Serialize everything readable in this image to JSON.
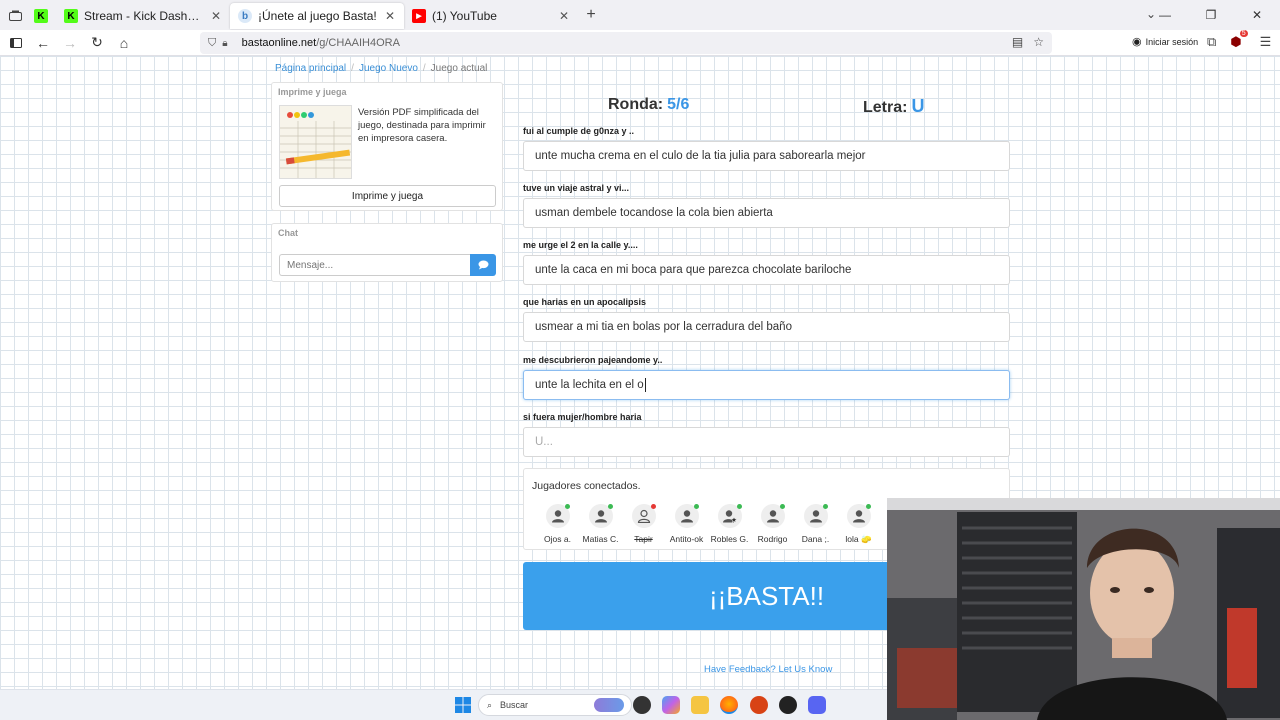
{
  "browser": {
    "tabs": [
      {
        "label": "",
        "favicon": "kick-icon",
        "color": "#53fc18"
      },
      {
        "label": "Stream - Kick Dashboard",
        "favicon": "kick-icon",
        "color": "#53fc18"
      },
      {
        "label": "¡Únete al juego Basta!",
        "favicon": "basta-icon",
        "color": "#7fb4e8",
        "active": true
      },
      {
        "label": "(1) YouTube",
        "favicon": "youtube-icon",
        "color": "#ff0000"
      }
    ],
    "url_host": "bastaonline.net",
    "url_path": "/g/CHAAIH4ORA",
    "signin_label": "Iniciar sesión",
    "notification_count": "5"
  },
  "breadcrumb": {
    "home": "Página principal",
    "new_game": "Juego Nuevo",
    "current": "Juego actual"
  },
  "print_panel": {
    "title": "Imprime y juega",
    "description": "Versión PDF simplificada del juego, destinada para imprimir en impresora casera.",
    "button_label": "Imprime y juega"
  },
  "chat": {
    "title": "Chat",
    "placeholder": "Mensaje..."
  },
  "game": {
    "round_label": "Ronda:",
    "round_value": "5/6",
    "letter_label": "Letra:",
    "letter_value": "U"
  },
  "questions": [
    {
      "label": "fui al cumple de g0nza y ..",
      "answer": "unte mucha crema en el culo de la tia julia para saborearla mejor"
    },
    {
      "label": "tuve un viaje astral y vi...",
      "answer": "usman dembele tocandose la cola bien abierta"
    },
    {
      "label": "me urge el 2 en la calle y....",
      "answer": "unte la caca en mi boca para que parezca chocolate bariloche"
    },
    {
      "label": "que harias en un apocalipsis",
      "answer": "usmear a mi tia en bolas por la cerradura del baño"
    },
    {
      "label": "me descubrieron pajeandome y..",
      "answer": "unte la lechita en el o"
    },
    {
      "label": "si fuera mujer/hombre haria",
      "answer": "",
      "placeholder": "U..."
    }
  ],
  "players": {
    "title": "Jugadores conectados.",
    "list": [
      {
        "name": "Ojos a.",
        "status": "online"
      },
      {
        "name": "Matias C.",
        "status": "online"
      },
      {
        "name": "Tapir",
        "status": "offline",
        "strike": true
      },
      {
        "name": "Antito-ok",
        "status": "online"
      },
      {
        "name": "Robles G.",
        "status": "online",
        "star": true
      },
      {
        "name": "Rodrigo",
        "status": "online"
      },
      {
        "name": "Dana ;.",
        "status": "online"
      },
      {
        "name": "lola 🧽",
        "status": "online"
      }
    ]
  },
  "basta_button": "¡¡BASTA!!",
  "feedback_link": "Have Feedback? Let Us Know",
  "taskbar": {
    "search_label": "Buscar"
  },
  "colors": {
    "accent": "#3a96e6",
    "basta_button": "#3aa0ec",
    "online": "#3cba54",
    "offline": "#e53935"
  }
}
